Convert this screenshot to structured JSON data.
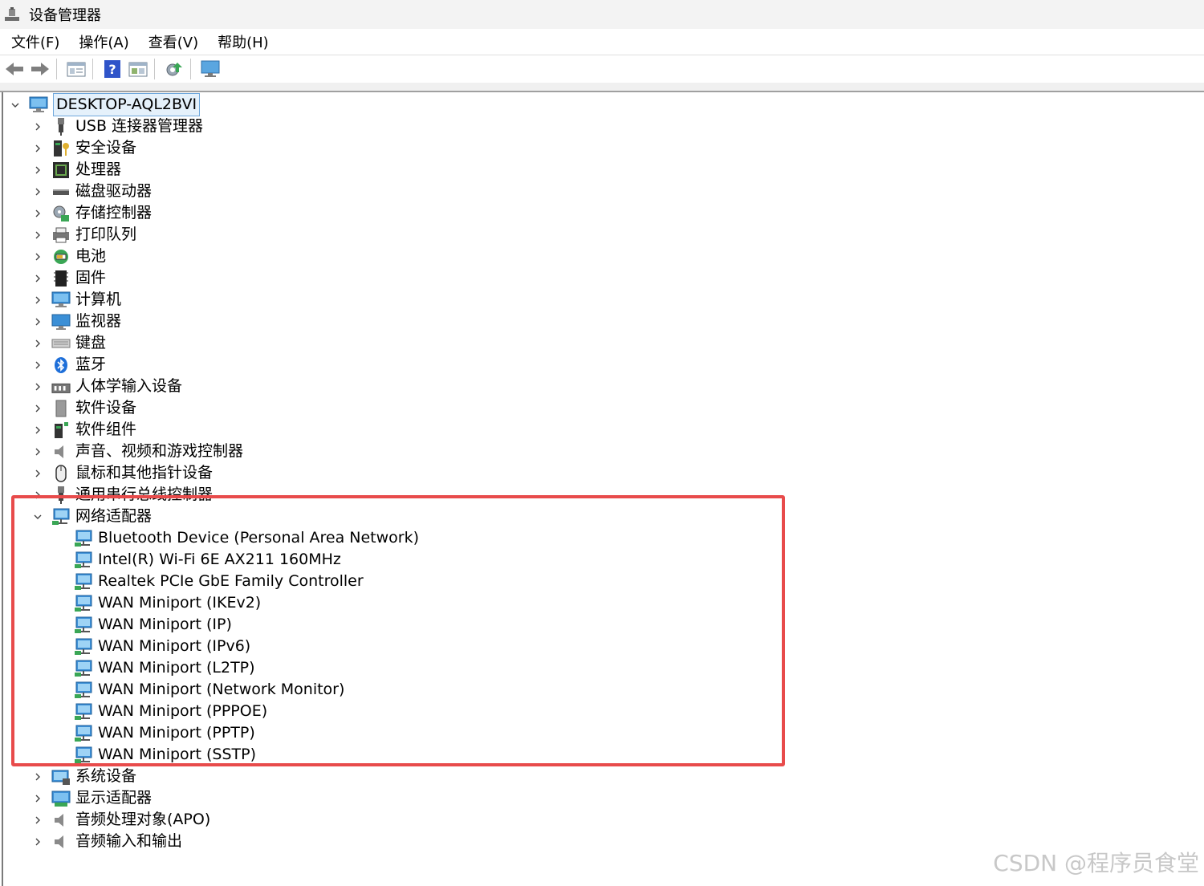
{
  "window": {
    "title": "设备管理器"
  },
  "menu": [
    "文件(F)",
    "操作(A)",
    "查看(V)",
    "帮助(H)"
  ],
  "toolbar": {
    "buttons": [
      "back-arrow-icon",
      "forward-arrow-icon",
      "properties-icon",
      "help-icon",
      "show-hide-icon",
      "update-driver-icon",
      "scan-hardware-icon"
    ]
  },
  "tree": {
    "root": "DESKTOP-AQL2BVI",
    "categories": [
      "USB 连接器管理器",
      "安全设备",
      "处理器",
      "磁盘驱动器",
      "存储控制器",
      "打印队列",
      "电池",
      "固件",
      "计算机",
      "监视器",
      "键盘",
      "蓝牙",
      "人体学输入设备",
      "软件设备",
      "软件组件",
      "声音、视频和游戏控制器",
      "鼠标和其他指针设备",
      "通用串行总线控制器"
    ],
    "network": {
      "label": "网络适配器",
      "devices": [
        "Bluetooth Device (Personal Area Network)",
        "Intel(R) Wi-Fi 6E AX211 160MHz",
        "Realtek PCIe GbE Family Controller",
        "WAN Miniport (IKEv2)",
        "WAN Miniport (IP)",
        "WAN Miniport (IPv6)",
        "WAN Miniport (L2TP)",
        "WAN Miniport (Network Monitor)",
        "WAN Miniport (PPPOE)",
        "WAN Miniport (PPTP)",
        "WAN Miniport (SSTP)"
      ]
    },
    "after": [
      "系统设备",
      "显示适配器",
      "音频处理对象(APO)",
      "音频输入和输出"
    ]
  },
  "watermark": "CSDN @程序员食堂",
  "colors": {
    "highlight": "#e84b4b",
    "selection": "#e5f1fb"
  }
}
